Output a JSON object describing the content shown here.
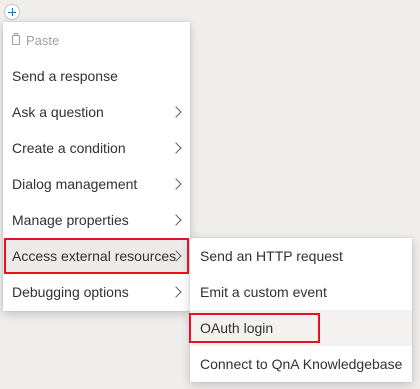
{
  "canvas": {
    "add_node_icon": "plus-icon"
  },
  "main_menu": {
    "items": [
      {
        "label": "Paste",
        "icon": "paste-icon",
        "disabled": true
      },
      {
        "label": "Send a response"
      },
      {
        "label": "Ask a question",
        "submenu": true
      },
      {
        "label": "Create a condition",
        "submenu": true
      },
      {
        "label": "Dialog management",
        "submenu": true
      },
      {
        "label": "Manage properties",
        "submenu": true
      },
      {
        "label": "Access external resources",
        "submenu": true,
        "active": true,
        "highlighted": true
      },
      {
        "label": "Debugging options",
        "submenu": true
      }
    ]
  },
  "sub_menu": {
    "items": [
      {
        "label": "Send an HTTP request"
      },
      {
        "label": "Emit a custom event"
      },
      {
        "label": "OAuth login",
        "hovered": true,
        "highlighted": true
      },
      {
        "label": "Connect to QnA Knowledgebase"
      }
    ]
  },
  "colors": {
    "highlight_border": "#e81123",
    "accent": "#0078d4"
  }
}
